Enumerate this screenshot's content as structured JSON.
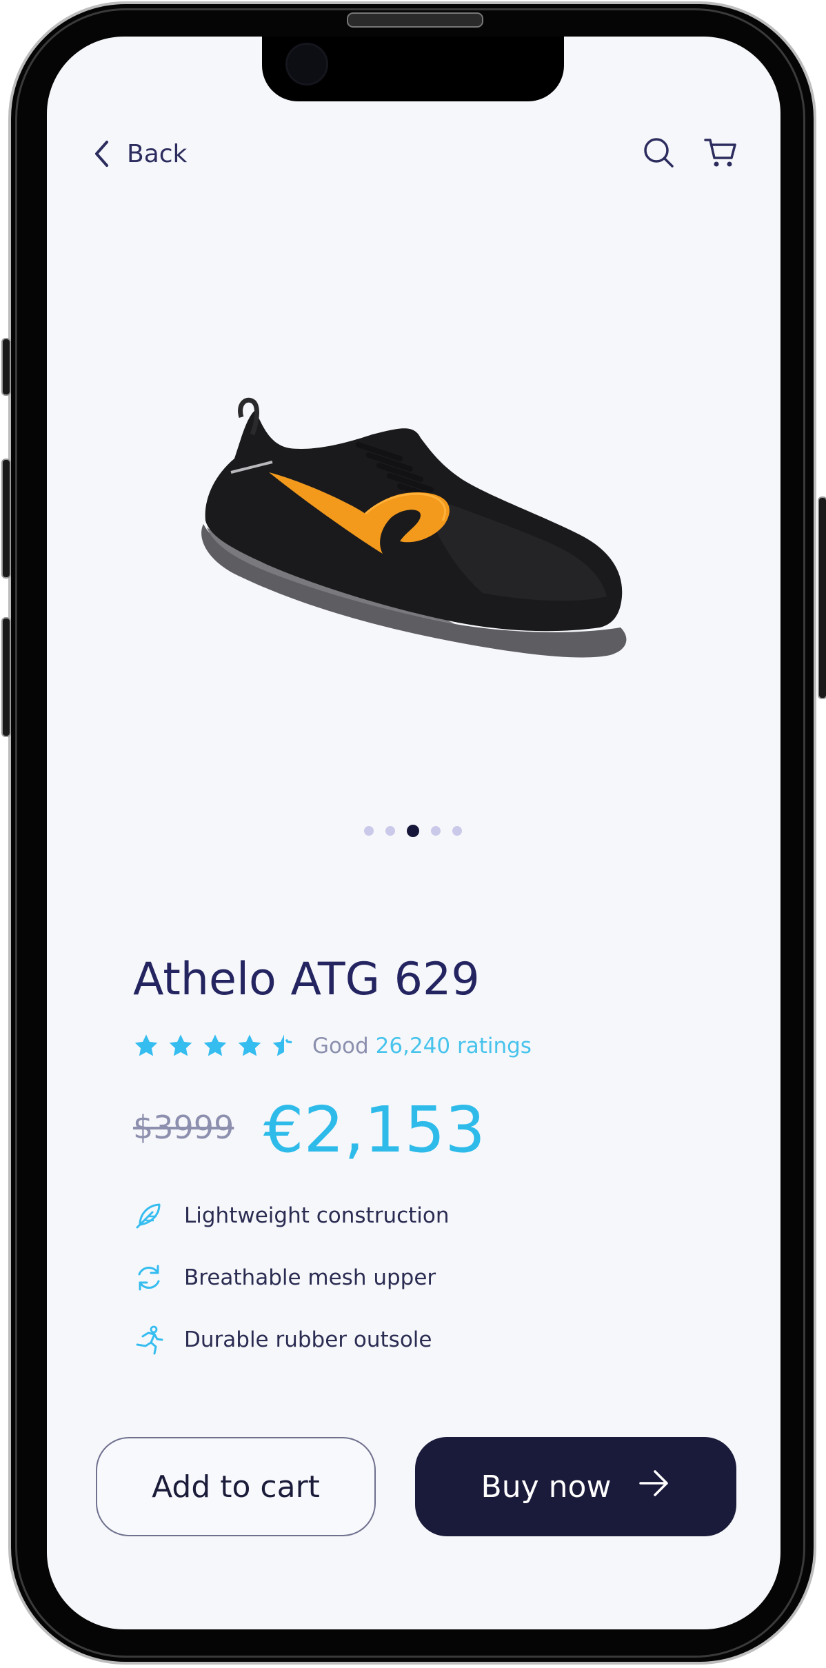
{
  "nav": {
    "back_label": "Back",
    "search_icon": "search-icon",
    "cart_icon": "cart-icon"
  },
  "carousel": {
    "image": "running-shoe-black-orange",
    "slide_count": 5,
    "active_slide": 3
  },
  "product": {
    "name": "Athelo ATG 629",
    "rating": {
      "stars": 4.5,
      "label": "Good",
      "count_text": "26,240 ratings"
    },
    "old_price": "$3999",
    "price": "€2,153",
    "features": [
      {
        "icon": "feather-icon",
        "label": "Lightweight construction"
      },
      {
        "icon": "refresh-icon",
        "label": "Breathable mesh upper"
      },
      {
        "icon": "runner-icon",
        "label": "Durable rubber outsole"
      }
    ]
  },
  "actions": {
    "add_to_cart": "Add to cart",
    "buy_now": "Buy now"
  },
  "colors": {
    "ink": "#23235e",
    "accent": "#2ebbea",
    "star": "#35bdf0",
    "button_dark": "#1a1a3a",
    "screen_bg": "#f6f7fa"
  }
}
